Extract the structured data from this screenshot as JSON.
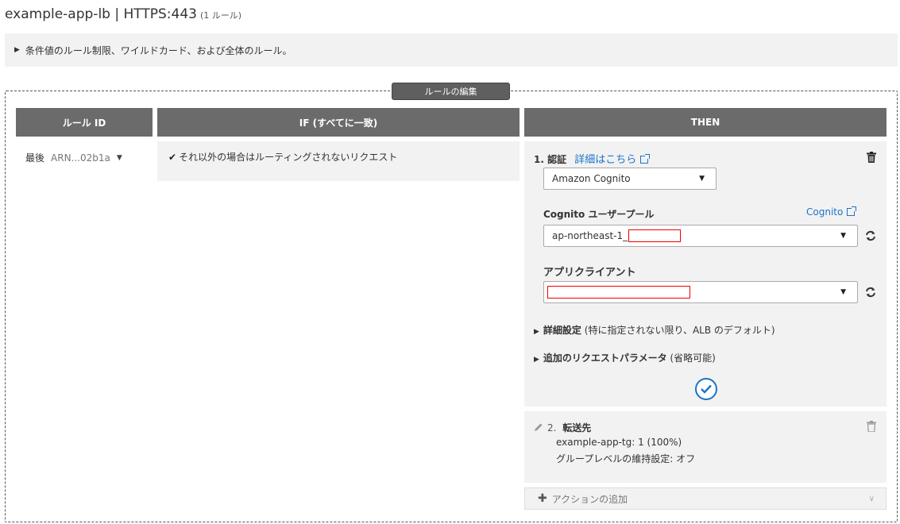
{
  "header": {
    "title": "example-app-lb | HTTPS:443",
    "rule_count": "(1 ルール)"
  },
  "info_bar": {
    "text": "条件値のルール制限、ワイルドカード、および全体のルール。"
  },
  "editor": {
    "frame_label": "ルールの編集",
    "columns": {
      "rule_id": "ルール ID",
      "if": "IF (すべてに一致)",
      "then": "THEN"
    }
  },
  "rule": {
    "priority": "最後",
    "arn": "ARN...02b1a",
    "condition": "それ以外の場合はルーティングされないリクエスト"
  },
  "then": {
    "auth": {
      "number": "1.",
      "title": "認証",
      "details_link": "詳細はこちら",
      "provider_select": "Amazon Cognito",
      "user_pool_label": "Cognito ユーザープール",
      "cognito_link": "Cognito",
      "user_pool_value": "ap-northeast-1_",
      "app_client_label": "アプリクライアント",
      "advanced_label": "詳細設定",
      "advanced_note": "(特に指定されない限り、ALB のデフォルト)",
      "extra_params_label": "追加のリクエストパラメータ",
      "extra_params_note": "(省略可能)"
    },
    "forward": {
      "number": "2.",
      "title": "転送先",
      "target_group": "example-app-tg: 1 (100%)",
      "stickiness": "グループレベルの維持設定: オフ"
    },
    "add_action": "アクションの追加"
  },
  "colors": {
    "accent": "#1a73c9",
    "header_bg": "#6b6b6b",
    "panel_bg": "#f2f2f2",
    "redact": "#ee0000"
  }
}
